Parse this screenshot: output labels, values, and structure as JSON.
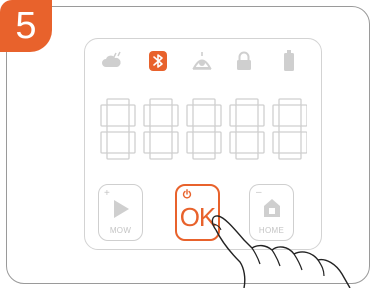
{
  "step": {
    "number": "5"
  },
  "display": {
    "digits": [
      "8",
      "8",
      "8",
      "8",
      "8"
    ],
    "active_status_icon": "bluetooth-icon"
  },
  "status_icons": [
    {
      "name": "rain-icon",
      "active": false
    },
    {
      "name": "bluetooth-icon",
      "active": true
    },
    {
      "name": "robot-icon",
      "active": false
    },
    {
      "name": "lock-icon",
      "active": false
    },
    {
      "name": "battery-icon",
      "active": false
    }
  ],
  "buttons": {
    "mow": {
      "label": "MOW",
      "modifier": "+"
    },
    "ok": {
      "label": "OK",
      "icon": "power-icon"
    },
    "home": {
      "label": "HOME",
      "modifier": "–"
    }
  },
  "colors": {
    "accent": "#e8622c",
    "inactive": "#cfcfcf",
    "outline": "#9a9a9a"
  }
}
